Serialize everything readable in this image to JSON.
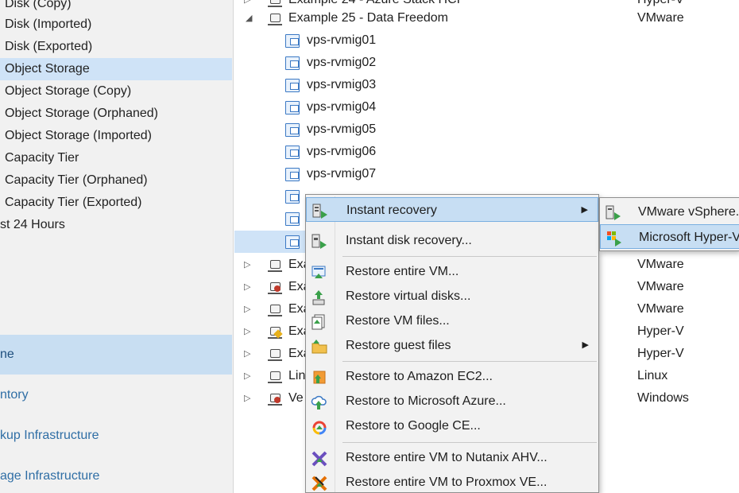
{
  "left_tree": {
    "items": [
      {
        "label": "Disk (Copy)"
      },
      {
        "label": "Disk (Imported)"
      },
      {
        "label": "Disk (Exported)"
      },
      {
        "label": "Object Storage",
        "selected": true
      },
      {
        "label": "Object Storage (Copy)"
      },
      {
        "label": "Object Storage (Orphaned)"
      },
      {
        "label": "Object Storage (Imported)"
      },
      {
        "label": "Capacity Tier"
      },
      {
        "label": "Capacity Tier (Orphaned)"
      },
      {
        "label": "Capacity Tier (Exported)"
      },
      {
        "label": "st 24 Hours"
      }
    ]
  },
  "nav": {
    "sections": [
      {
        "label": "ne",
        "active": true
      },
      {
        "label": "ntory"
      },
      {
        "label": "kup Infrastructure"
      },
      {
        "label": "age Infrastructure"
      }
    ]
  },
  "tree": {
    "top_partial_name": "Example 24 - Azure Stack HCI",
    "top_partial_type": "Hyper-V",
    "expanded_job": {
      "name": "Example 25 - Data Freedom",
      "type": "VMware"
    },
    "vms": [
      "vps-rvmig01",
      "vps-rvmig02",
      "vps-rvmig03",
      "vps-rvmig04",
      "vps-rvmig05",
      "vps-rvmig06",
      "vps-rvmig07"
    ],
    "hidden_vms": [
      "vps-rvmig08",
      "",
      ""
    ],
    "jobs": [
      {
        "name": "Exa",
        "type": "VMware"
      },
      {
        "name": "Exa",
        "type": "VMware"
      },
      {
        "name": "Exa",
        "type": "VMware"
      },
      {
        "name": "Exa",
        "type": "Hyper-V"
      },
      {
        "name": "Exa",
        "type": "Hyper-V"
      },
      {
        "name": "Lin",
        "type": "Linux"
      },
      {
        "name": "Ve",
        "type": "Windows"
      }
    ]
  },
  "context_menu": {
    "items": [
      {
        "label": "Instant recovery",
        "icon": "instant-recovery-icon",
        "submenu": true,
        "highlighted": true
      },
      {
        "label": "Instant disk recovery...",
        "icon": "instant-disk-recovery-icon"
      },
      {
        "label": "Restore entire VM...",
        "icon": "restore-vm-icon"
      },
      {
        "label": "Restore virtual disks...",
        "icon": "restore-disks-icon"
      },
      {
        "label": "Restore VM files...",
        "icon": "restore-files-icon"
      },
      {
        "label": "Restore guest files",
        "icon": "guest-files-folder-icon",
        "submenu": true
      },
      {
        "label": "Restore to Amazon EC2...",
        "icon": "amazon-ec2-icon"
      },
      {
        "label": "Restore to Microsoft Azure...",
        "icon": "azure-cloud-icon"
      },
      {
        "label": "Restore to Google CE...",
        "icon": "google-cloud-icon"
      },
      {
        "label": "Restore entire VM to Nutanix AHV...",
        "icon": "nutanix-icon"
      },
      {
        "label": "Restore entire VM to Proxmox VE...",
        "icon": "proxmox-icon"
      }
    ]
  },
  "submenu": {
    "items": [
      {
        "label": "VMware vSphere...",
        "icon": "vmware-icon"
      },
      {
        "label": "Microsoft Hyper-V...",
        "icon": "hyperv-icon",
        "highlighted": true
      }
    ]
  },
  "colors": {
    "selection": "#cfe3f7",
    "menu_highlight": "#c7def3",
    "nav_link": "#2f6ea5"
  }
}
